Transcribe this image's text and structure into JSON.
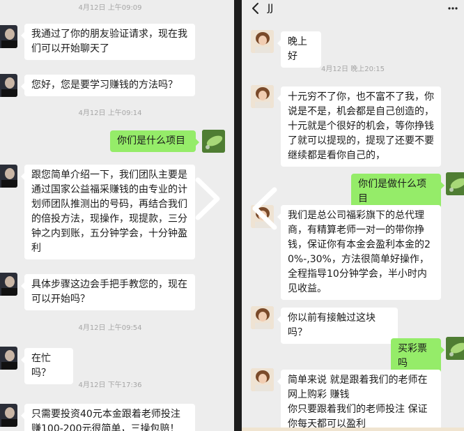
{
  "left": {
    "timestamps": [
      "4月12日 上午09:09",
      "4月12日 上午09:14",
      "4月12日 上午09:54",
      "4月12日 下午17:36"
    ],
    "messages": [
      "我通过了你的朋友验证请求，现在我们可以开始聊天了",
      "您好，您是要学习赚钱的方法吗？",
      "你们是什么项目",
      "跟您简单介绍一下，我们团队主要是通过国家公益福采赚钱的由专业的计划师团队推测出的号码，再结合我们的倍投方法，现操作，现提款，三分钟之内到账，五分钟学会，十分钟盈利",
      "具体步骤这边会手把手教您的，现在可以开始吗？",
      "在忙吗？",
      "只需要投资40元本金跟着老师投注赚100-200元很简单，三操包赔！"
    ]
  },
  "right": {
    "title": "JJ",
    "timestamps": [
      "4月12日 晚上20:15"
    ],
    "messages": [
      "晚上好",
      "十元穷不了你，也不富不了我，你说是不是，机会都是自己创造的，十元就是个很好的机会，等你挣钱了就可以提现的，提现了还要不要继续都是看你自己的，",
      "你们是做什么项目",
      "我们是总公司福彩旗下的总代理商，有精算老师一对一的带你挣钱，保证你有本金会盈利本金的20%-,30%，方法很简单好操作，全程指导10分钟学会，半小时内见收益。",
      "你以前有接触过这块吗？",
      "买彩票吗",
      "简单来说 就是跟着我们的老师在网上购彩 赚钱\n你只要跟着我们的老师投注 保证你每天都可以盈利"
    ]
  },
  "icons": {
    "back": "chevron-left-icon",
    "more": "more-dots-icon",
    "next": "chevron-right-icon",
    "prev": "chevron-left-icon"
  },
  "colors": {
    "chat_bg": "#ededed",
    "incoming_bubble": "#ffffff",
    "outgoing_bubble": "#95ec69",
    "timestamp": "#a6a6a6"
  }
}
